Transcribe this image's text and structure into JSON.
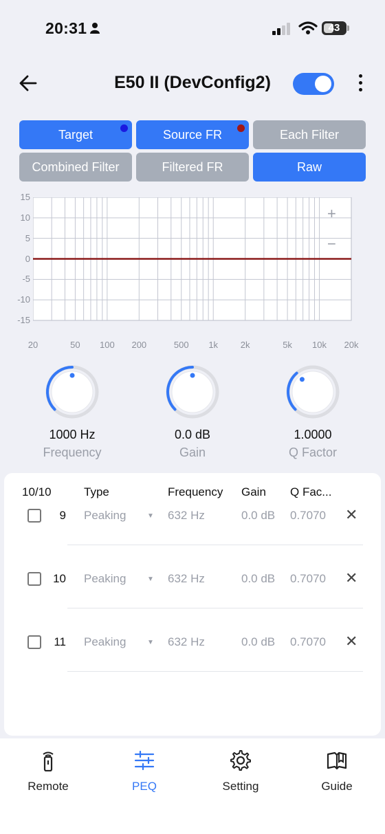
{
  "status_bar": {
    "time": "20:31",
    "battery": "43"
  },
  "header": {
    "title": "E50 II (DevConfig2)",
    "enabled": true
  },
  "mode_buttons": [
    {
      "label": "Target",
      "active": true,
      "dot_color": "#1a1ae0"
    },
    {
      "label": "Source FR",
      "active": true,
      "dot_color": "#a01717"
    },
    {
      "label": "Each Filter",
      "active": false
    },
    {
      "label": "Combined Filter",
      "active": false
    },
    {
      "label": "Filtered FR",
      "active": false
    },
    {
      "label": "Raw",
      "active": true
    }
  ],
  "chart": {
    "y_ticks": [
      "15",
      "10",
      "5",
      "0",
      "-5",
      "-10",
      "-15"
    ],
    "x_ticks": [
      "20",
      "50",
      "100",
      "200",
      "500",
      "1k",
      "2k",
      "5k",
      "10k",
      "20k"
    ],
    "zoom_in": "+",
    "zoom_out": "−"
  },
  "chart_data": {
    "type": "line",
    "x_scale": "log",
    "xlim": [
      20,
      20000
    ],
    "ylim": [
      -15,
      15
    ],
    "series": [
      {
        "x": [
          20,
          20000
        ],
        "y": [
          0,
          0
        ],
        "color": "#8b1a1a"
      }
    ],
    "grid": true
  },
  "knobs": [
    {
      "value": "1000 Hz",
      "label": "Frequency",
      "level": 0.5
    },
    {
      "value": "0.0 dB",
      "label": "Gain",
      "level": 0.5
    },
    {
      "value": "1.0000",
      "label": "Q Factor",
      "level": 0.35
    }
  ],
  "filter_table": {
    "headers": {
      "count": "10/10",
      "type": "Type",
      "frequency": "Frequency",
      "gain": "Gain",
      "q": "Q Fac..."
    },
    "rows": [
      {
        "index": "9",
        "type": "Peaking",
        "frequency": "632 Hz",
        "gain": "0.0 dB",
        "q": "0.7070"
      },
      {
        "index": "10",
        "type": "Peaking",
        "frequency": "632 Hz",
        "gain": "0.0 dB",
        "q": "0.7070"
      },
      {
        "index": "11",
        "type": "Peaking",
        "frequency": "632 Hz",
        "gain": "0.0 dB",
        "q": "0.7070"
      }
    ]
  },
  "bottom_nav": [
    {
      "label": "Remote",
      "icon": "remote-icon",
      "active": false
    },
    {
      "label": "PEQ",
      "icon": "sliders-icon",
      "active": true
    },
    {
      "label": "Setting",
      "icon": "gear-icon",
      "active": false
    },
    {
      "label": "Guide",
      "icon": "book-icon",
      "active": false
    }
  ],
  "colors": {
    "accent": "#3478f6",
    "inactive_button": "#a6adb8",
    "curve": "#8b1a1a"
  }
}
